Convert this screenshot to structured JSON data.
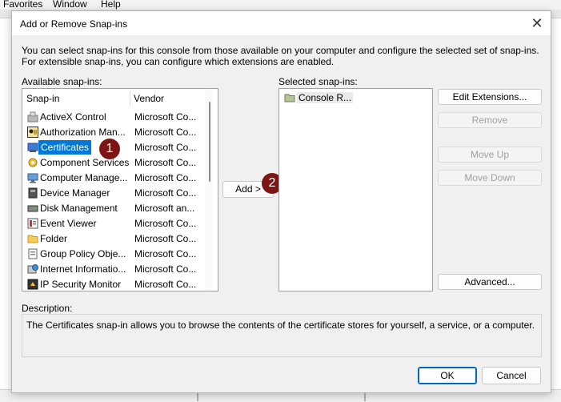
{
  "background": {
    "menu": [
      "Favorites",
      "Window",
      "Help"
    ]
  },
  "dialog": {
    "title": "Add or Remove Snap-ins",
    "intro_line1": "You can select snap-ins for this console from those available on your computer and configure the selected set of snap-ins.",
    "intro_line2": "For extensible snap-ins, you can configure which extensions are enabled.",
    "available_label": "Available snap-ins:",
    "selected_label": "Selected snap-ins:",
    "columns": {
      "snapin": "Snap-in",
      "vendor": "Vendor"
    },
    "available": [
      {
        "name": "ActiveX Control",
        "vendor": "Microsoft Co...",
        "icon": "activex-icon"
      },
      {
        "name": "Authorization Man...",
        "vendor": "Microsoft Co...",
        "icon": "authorization-icon"
      },
      {
        "name": "Certificates",
        "vendor": "Microsoft Co...",
        "icon": "certificates-icon",
        "selected": true
      },
      {
        "name": "Component Services",
        "vendor": "Microsoft Co...",
        "icon": "component-services-icon"
      },
      {
        "name": "Computer Manage...",
        "vendor": "Microsoft Co...",
        "icon": "computer-management-icon"
      },
      {
        "name": "Device Manager",
        "vendor": "Microsoft Co...",
        "icon": "device-manager-icon"
      },
      {
        "name": "Disk Management",
        "vendor": "Microsoft an...",
        "icon": "disk-management-icon"
      },
      {
        "name": "Event Viewer",
        "vendor": "Microsoft Co...",
        "icon": "event-viewer-icon"
      },
      {
        "name": "Folder",
        "vendor": "Microsoft Co...",
        "icon": "folder-icon"
      },
      {
        "name": "Group Policy Obje...",
        "vendor": "Microsoft Co...",
        "icon": "group-policy-icon"
      },
      {
        "name": "Internet Informatio...",
        "vendor": "Microsoft Co...",
        "icon": "iis-icon"
      },
      {
        "name": "IP Security Monitor",
        "vendor": "Microsoft Co...",
        "icon": "ip-security-icon"
      }
    ],
    "selected": [
      {
        "name": "Console R...",
        "icon": "console-root-folder-icon"
      }
    ],
    "buttons": {
      "add": "Add >",
      "edit_extensions": "Edit Extensions...",
      "remove": "Remove",
      "move_up": "Move Up",
      "move_down": "Move Down",
      "advanced": "Advanced...",
      "ok": "OK",
      "cancel": "Cancel"
    },
    "description_label": "Description:",
    "description": "The Certificates snap-in allows you to browse the contents of the certificate stores for yourself, a service, or a computer.",
    "markers": [
      "1",
      "2"
    ]
  },
  "colors": {
    "selection": "#0078d7",
    "marker": "#7d1515",
    "dialog_bg": "#f0f0f0"
  }
}
